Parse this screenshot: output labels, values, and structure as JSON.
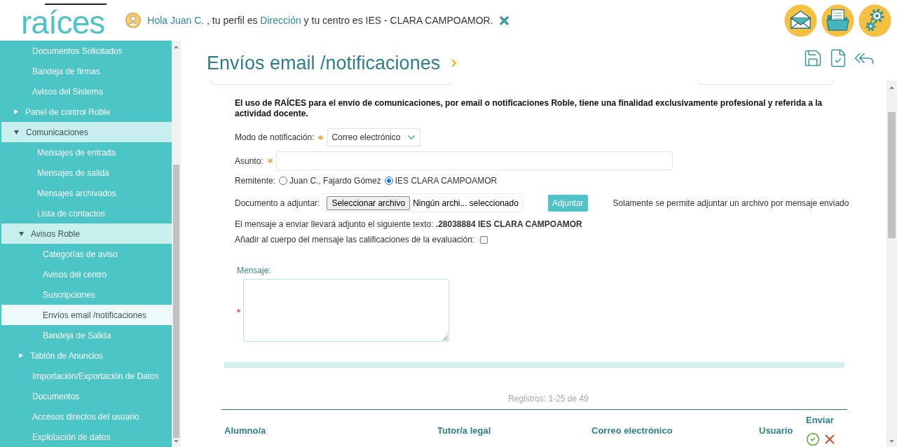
{
  "header": {
    "logo": "raíces",
    "greeting": [
      {
        "kind": "link",
        "text": "Hola Juan C."
      },
      {
        "kind": "text",
        "text": " , tu perfil es "
      },
      {
        "kind": "link",
        "text": "Dirección"
      },
      {
        "kind": "text",
        "text": " y tu centro es IES - CLARA CAMPOAMOR."
      }
    ]
  },
  "sidebar": {
    "items": [
      {
        "label": "Documentos Solicitados",
        "selected": false
      },
      {
        "label": "Bandeja de firmas",
        "selected": false
      },
      {
        "label": "Avisos del Sistema",
        "selected": false
      },
      {
        "label": "Panel de control Roble",
        "selected": false,
        "expanded": false
      },
      {
        "label": "Comunicaciones",
        "selected": false,
        "expanded": true,
        "children": [
          {
            "label": "Mensajes de entrada",
            "selected": false
          },
          {
            "label": "Mensajes de salida",
            "selected": false
          },
          {
            "label": "Mensajes archivados",
            "selected": false
          },
          {
            "label": "Lista de contactos",
            "selected": false
          },
          {
            "label": "Avisos Roble",
            "selected": false,
            "expanded": true,
            "children": [
              {
                "label": "Categorías de aviso",
                "selected": false
              },
              {
                "label": "Avisos del centro",
                "selected": false
              },
              {
                "label": "Suscripciones",
                "selected": false
              },
              {
                "label": "Envíos email /notificaciones",
                "selected": true
              },
              {
                "label": "Bandeja de Salida",
                "selected": false
              }
            ]
          },
          {
            "label": "Tablón de Anuncios",
            "selected": false,
            "expanded": false
          }
        ]
      },
      {
        "label": "Importación/Exportación de Datos",
        "selected": false
      },
      {
        "label": "Documentos",
        "selected": false
      },
      {
        "label": "Accesos directos del usuario",
        "selected": false
      },
      {
        "label": "Explotación de datos",
        "selected": false
      }
    ]
  },
  "page": {
    "title": "Envíos email /notificaciones"
  },
  "form": {
    "notice": "El uso de RAÍCES para el envío de comunicaciones, por email o notificaciones Roble, tiene una finalidad exclusivamente profesional y referida a la actividad docente.",
    "fields": [
      {
        "kind": "select",
        "label": "Modo de notificación:",
        "required": true,
        "value": "Correo electrónico"
      },
      {
        "kind": "text",
        "label": "Asunto:",
        "required": true
      },
      {
        "kind": "radio",
        "label": "Remitente:",
        "options": [
          {
            "label": "Juan C., Fajardo Gómez",
            "selected": false
          },
          {
            "label": "IES CLARA CAMPOAMOR",
            "selected": true
          }
        ]
      },
      {
        "kind": "file",
        "label": "Documento a adjuntar:",
        "button": "Seleccionar archivo",
        "value": "Ningún archi... seleccionado",
        "action": "Adjuntar",
        "hint": "Solamente se permite adjuntar un archivo por mensaje enviado"
      },
      {
        "kind": "info",
        "text": "El mensaje a enviar llevará adjunto el siguiente texto: **.28038884 IES CLARA CAMPOAMOR**"
      },
      {
        "kind": "checkbox",
        "label": "Añadir al cuerpo del mensaje las calificaciones de la evaluación:",
        "checked": false
      },
      {
        "kind": "textarea",
        "label": "Mensaje:",
        "required": true
      }
    ]
  },
  "table": {
    "records": "Registros: 1-25 de 49",
    "columns": [
      {
        "label": "Alumno/a",
        "kind": "text"
      },
      {
        "label": "Tutor/a legal",
        "kind": "text"
      },
      {
        "label": "Correo electrónico",
        "kind": "text"
      },
      {
        "label": "Usuario",
        "kind": "text"
      },
      {
        "label": "Enviar",
        "kind": "actions"
      }
    ]
  }
}
